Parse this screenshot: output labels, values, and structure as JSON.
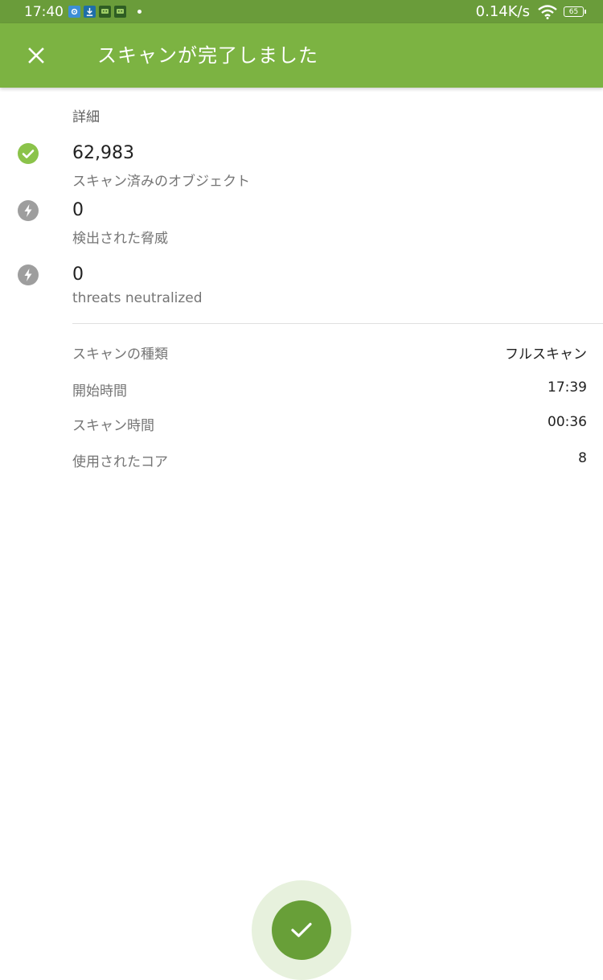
{
  "status_bar": {
    "time": "17:40",
    "notification_icons": [
      "settings-icon",
      "download-icon",
      "app-icon",
      "app-icon"
    ],
    "speed": "0.14K/s",
    "battery": "65"
  },
  "app_bar": {
    "title": "スキャンが完了しました",
    "close_icon": "close-icon",
    "color": "#7cb342"
  },
  "details": {
    "section_label": "詳細",
    "stats": [
      {
        "value": "62,983",
        "label": "スキャン済みのオブジェクト",
        "icon": "check-circle-icon",
        "color": "#8bc34a"
      },
      {
        "value": "0",
        "label": "検出された脅威",
        "icon": "bolt-icon",
        "color": "#9e9e9e"
      },
      {
        "value": "0",
        "label": "threats neutralized",
        "icon": "bolt-icon",
        "color": "#9e9e9e"
      }
    ],
    "info": [
      {
        "key": "スキャンの種類",
        "value": "フルスキャン"
      },
      {
        "key": "開始時間",
        "value": "17:39"
      },
      {
        "key": "スキャン時間",
        "value": "00:36"
      },
      {
        "key": "使用されたコア",
        "value": "8"
      }
    ]
  },
  "fab": {
    "icon": "check-icon",
    "color": "#689f38"
  }
}
